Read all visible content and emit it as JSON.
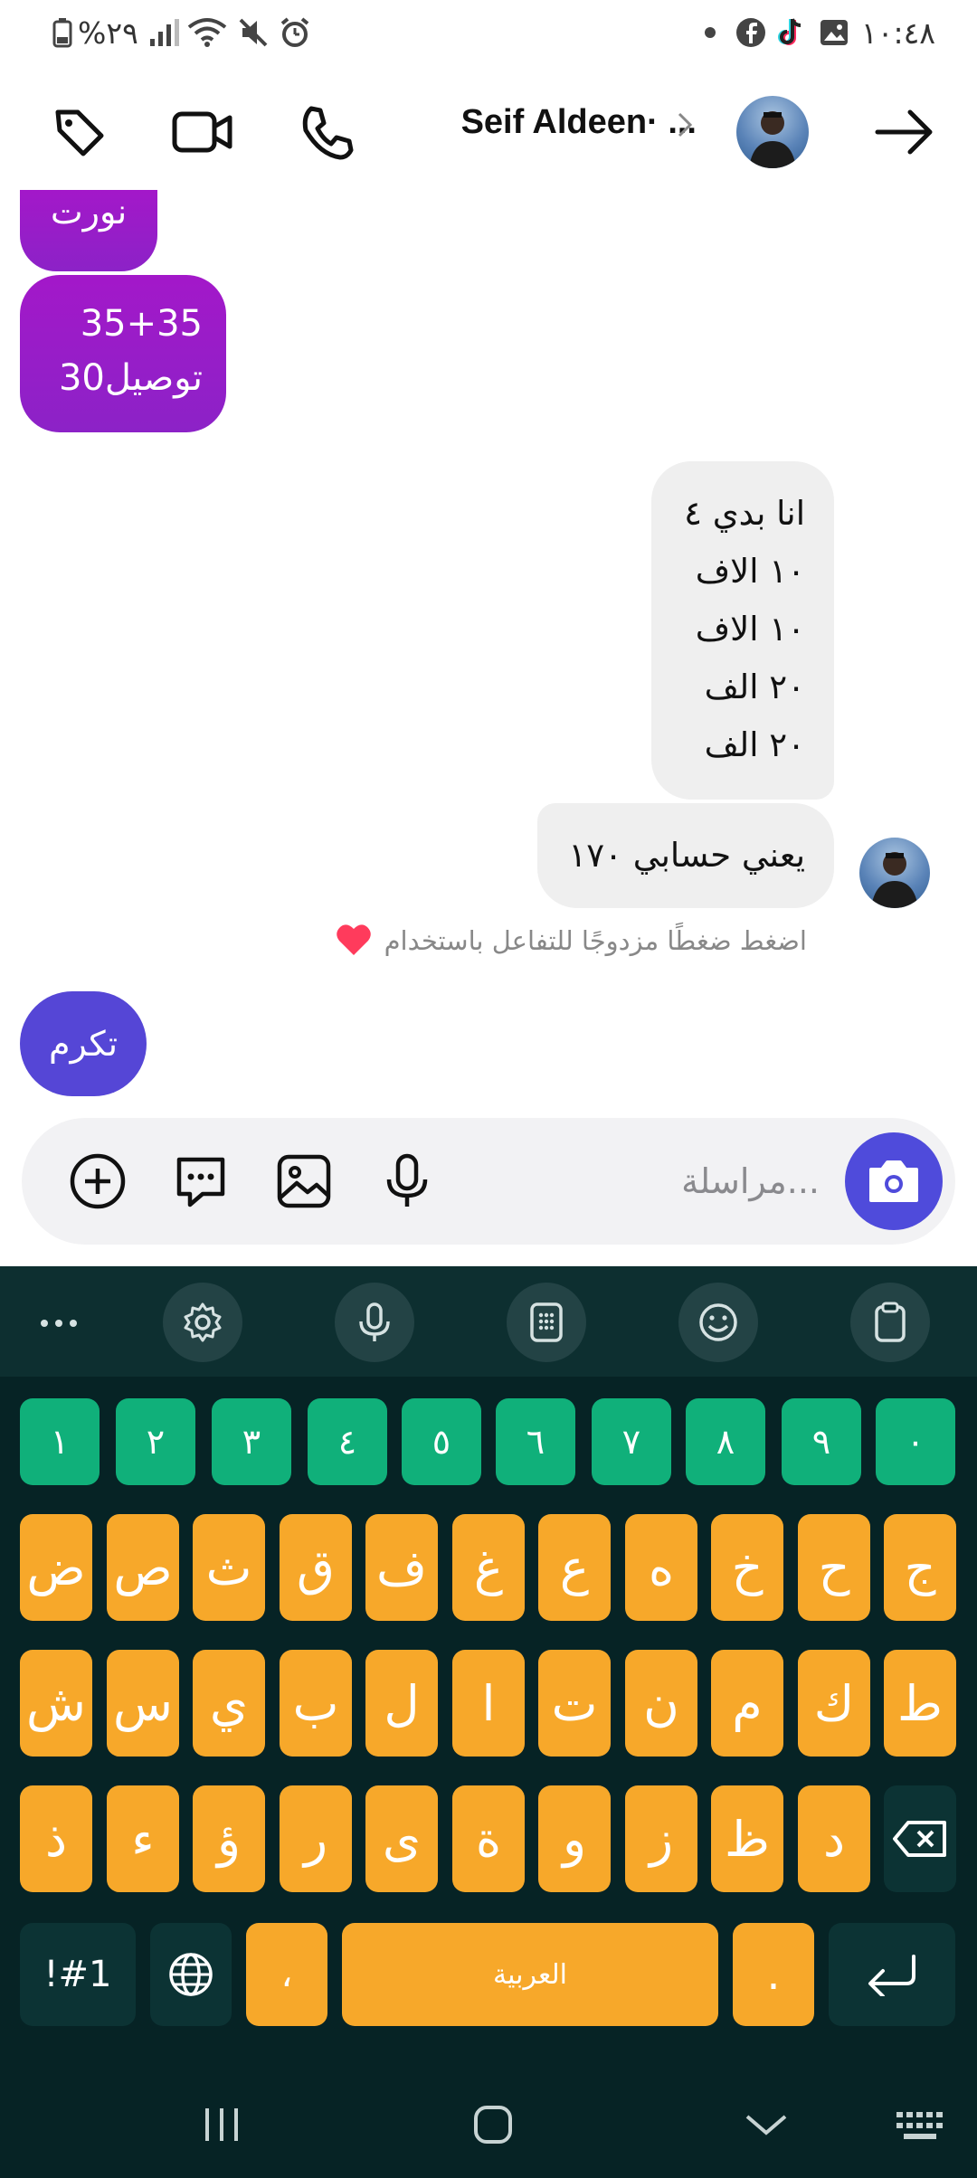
{
  "status": {
    "time": "١٠:٤٨",
    "battery_pct": "%٢٩",
    "left_icons": [
      "dot-icon",
      "facebook-icon",
      "tiktok-icon",
      "gallery-icon"
    ],
    "right_icons": [
      "battery-icon",
      "signal-icon",
      "wifi-icon",
      "mute-icon",
      "alarm-icon"
    ]
  },
  "header": {
    "contact_name": "Seif Aldeen· ...",
    "icons": [
      "back-arrow-icon",
      "chevron-right-icon",
      "phone-icon",
      "video-icon",
      "tag-icon"
    ]
  },
  "messages": {
    "sent_top": "نورت",
    "sent_price_line1": "35+35",
    "sent_price_line2": "30توصيل",
    "recv_list_line1": "انا بدي ٤",
    "recv_list_line2": "١٠ الاف",
    "recv_list_line3": "١٠ الاف",
    "recv_list_line4": "٢٠ الف",
    "recv_list_line5": "٢٠ الف",
    "recv_total": "يعني حسابي ١٧٠",
    "hint": "اضغط ضغطًا مزدوجًا للتفاعل باستخدام",
    "sent_last": "تكرم",
    "colors": {
      "sent": "#a318c9",
      "sent_last": "#5546d6",
      "received": "#efefef"
    }
  },
  "composer": {
    "placeholder": "مراسلة...",
    "icons": [
      "camera-icon",
      "mic-icon",
      "image-icon",
      "sticker-icon",
      "plus-icon"
    ],
    "camera_color": "#4f4bdb"
  },
  "keyboard": {
    "toolbar": [
      "more-icon",
      "settings-icon",
      "voice-icon",
      "keypad-icon",
      "emoji-icon",
      "clipboard-icon"
    ],
    "numbers": [
      "١",
      "٢",
      "٣",
      "٤",
      "٥",
      "٦",
      "٧",
      "٨",
      "٩",
      "٠"
    ],
    "row1": [
      "ض",
      "ص",
      "ث",
      "ق",
      "ف",
      "غ",
      "ع",
      "ه",
      "خ",
      "ح",
      "ج"
    ],
    "row2": [
      "ش",
      "س",
      "ي",
      "ب",
      "ل",
      "ا",
      "ت",
      "ن",
      "م",
      "ك",
      "ط"
    ],
    "row3": [
      "ذ",
      "ء",
      "ؤ",
      "ر",
      "ى",
      "ة",
      "و",
      "ز",
      "ظ",
      "د"
    ],
    "symbols_label": "!#1",
    "comma": "،",
    "space_label": "العربية",
    "period": ".",
    "colors": {
      "numbers": "#10b07a",
      "letters": "#f7a82a",
      "background": "#062325"
    }
  },
  "navbar": {
    "icons": [
      "recents-icon",
      "home-icon",
      "back-icon",
      "keyboard-switch-icon"
    ]
  }
}
